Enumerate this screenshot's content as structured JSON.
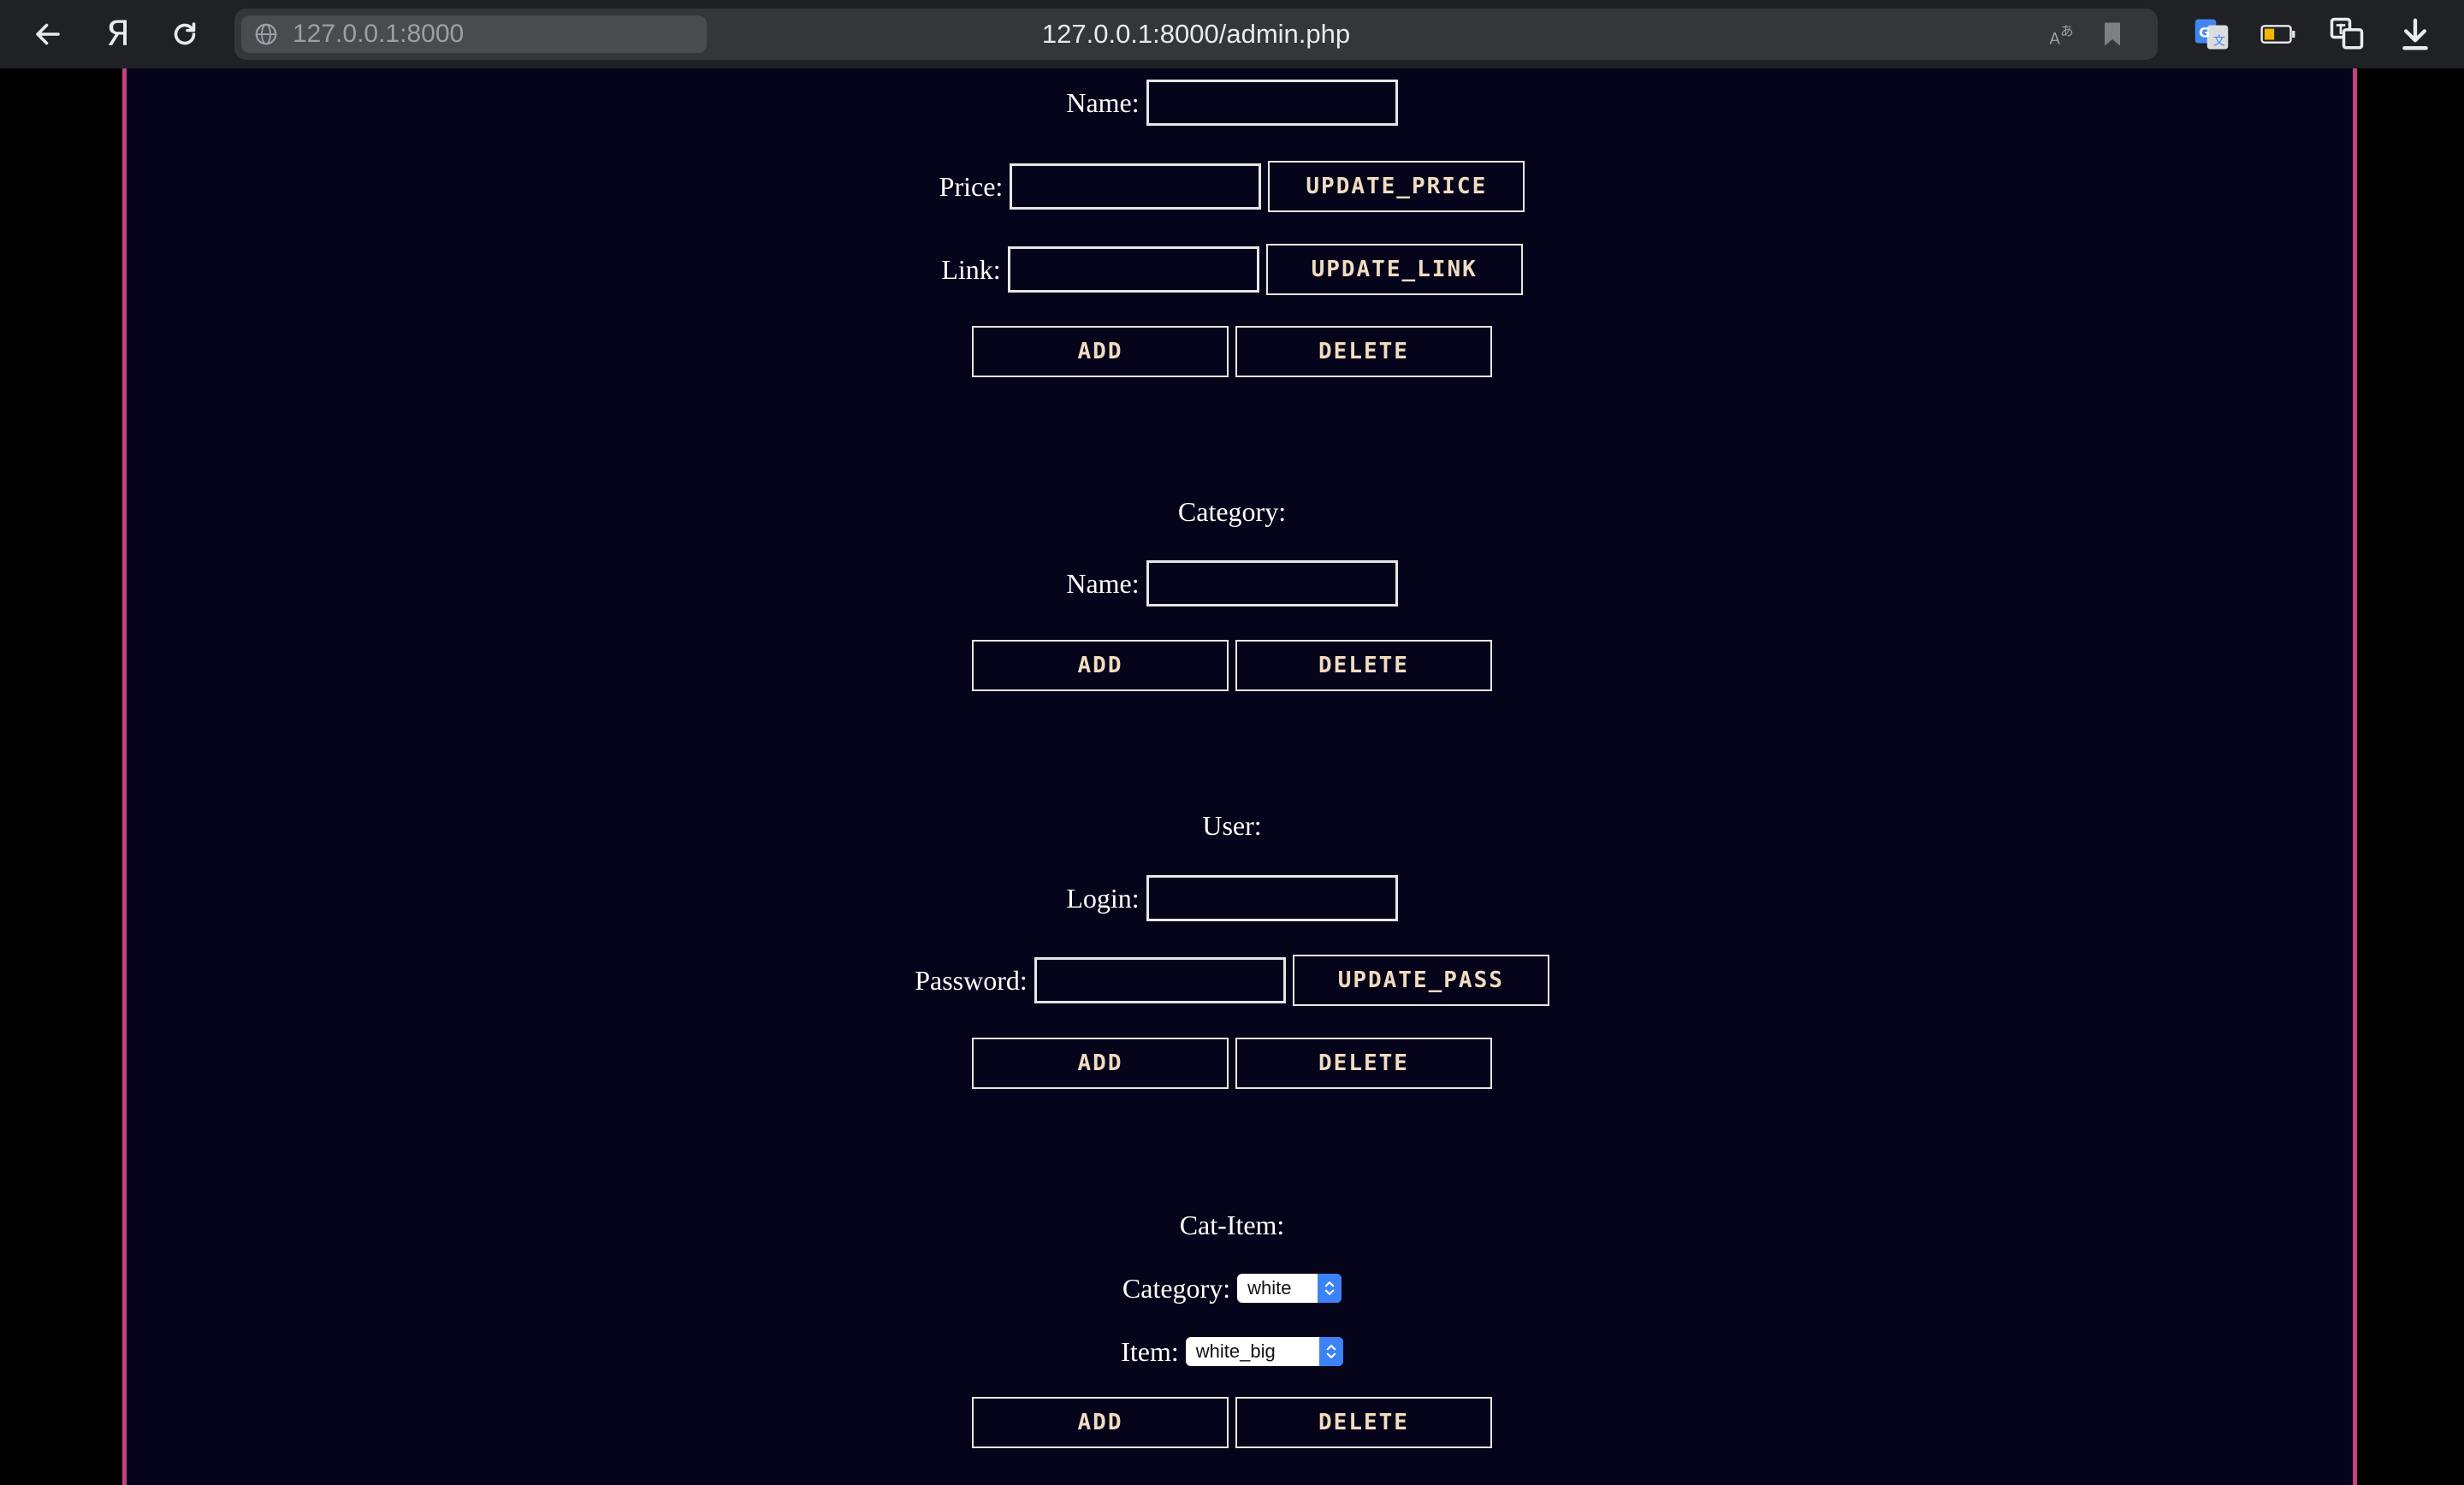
{
  "browser": {
    "origin_chip": "127.0.0.1:8000",
    "url": "127.0.0.1:8000/admin.php"
  },
  "item_section": {
    "name_label": "Name:",
    "price_label": "Price:",
    "update_price": "UPDATE_PRICE",
    "link_label": "Link:",
    "update_link": "UPDATE_LINK",
    "add": "ADD",
    "delete": "DELETE"
  },
  "category_section": {
    "title": "Category:",
    "name_label": "Name:",
    "add": "ADD",
    "delete": "DELETE"
  },
  "user_section": {
    "title": "User:",
    "login_label": "Login:",
    "password_label": "Password:",
    "update_pass": "UPDATE_PASS",
    "add": "ADD",
    "delete": "DELETE"
  },
  "catitem_section": {
    "title": "Cat-Item:",
    "category_label": "Category:",
    "category_value": "white",
    "item_label": "Item:",
    "item_value": "white_big",
    "add": "ADD",
    "delete": "DELETE"
  },
  "colors": {
    "page_background": "#05041a",
    "border_accent": "#c7407f",
    "button_text": "#f0dcc0",
    "select_accent": "#3b82f6"
  }
}
